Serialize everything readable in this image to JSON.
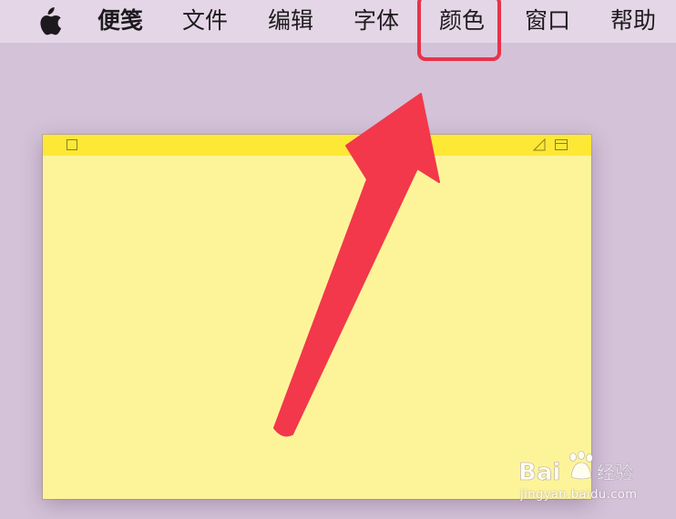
{
  "menubar": {
    "apple_icon": "apple-logo-icon",
    "items": {
      "app": "便笺",
      "file": "文件",
      "edit": "编辑",
      "font": "字体",
      "color": "颜色",
      "window": "窗口",
      "help": "帮助"
    },
    "highlighted_item": "颜色"
  },
  "annotation": {
    "highlight_color": "#e8334a",
    "arrow_color": "#f2384a"
  },
  "note": {
    "title_bar_color": "#fde836",
    "body_color": "#fdf49a",
    "content": ""
  },
  "watermark": {
    "logo_text": "Bai 经验",
    "url_text": "jingyan.baidu.com"
  }
}
